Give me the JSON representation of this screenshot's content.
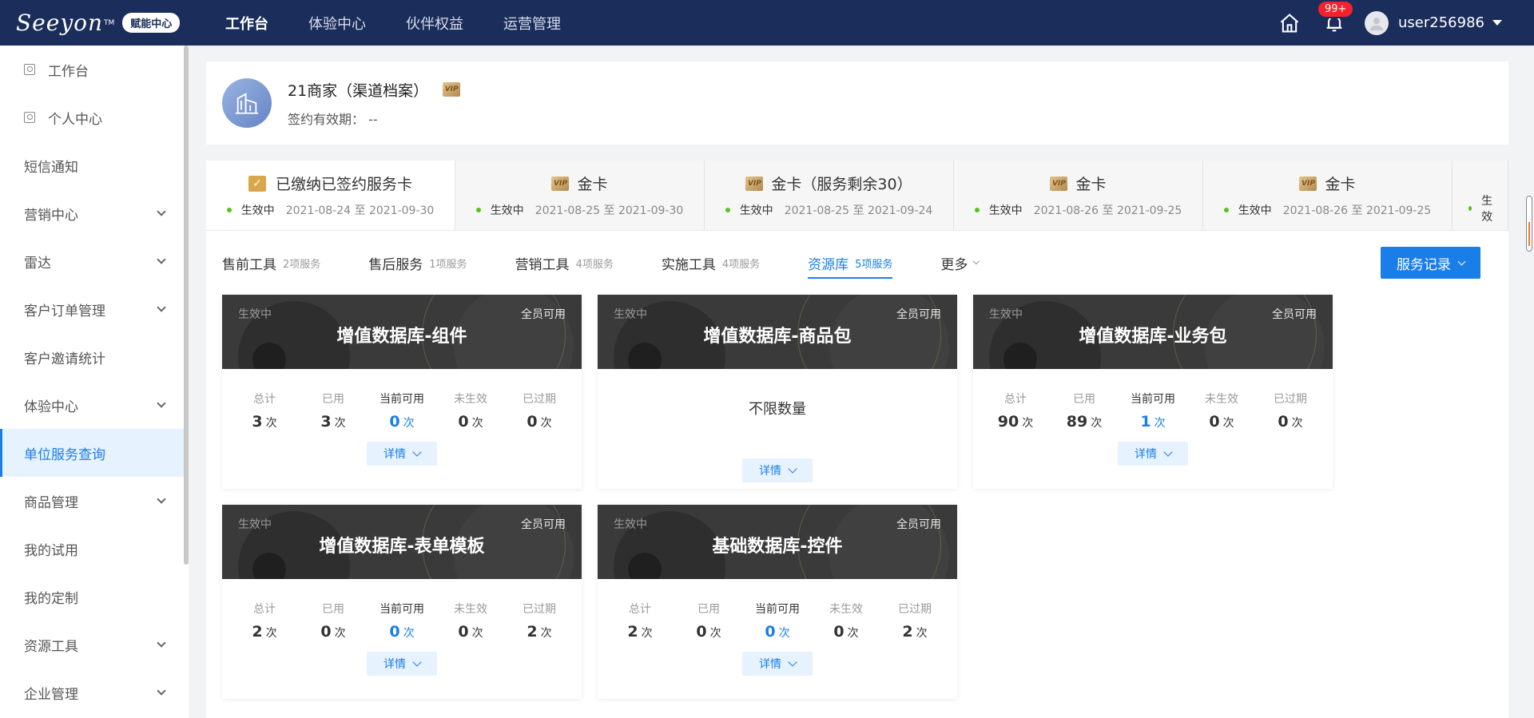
{
  "topbar": {
    "logo": "Seeyon",
    "logo_tm": "TM",
    "badge": "赋能中心",
    "nav": [
      "工作台",
      "体验中心",
      "伙伴权益",
      "运营管理"
    ],
    "notif_count": "99+",
    "username": "user256986"
  },
  "sidebar": {
    "items": [
      "工作台",
      "个人中心",
      "短信通知",
      "营销中心",
      "雷达",
      "客户订单管理",
      "客户邀请统计",
      "体验中心",
      "单位服务查询",
      "商品管理",
      "我的试用",
      "我的定制",
      "资源工具",
      "企业管理"
    ]
  },
  "profile": {
    "name": "21商家（渠道档案）",
    "vip": "VIP",
    "valid_label": "签约有效期：",
    "valid_value": "--"
  },
  "cards": [
    {
      "title": "已缴纳已签约服务卡",
      "status": "生效中",
      "range": "2021-08-24 至 2021-09-30"
    },
    {
      "title": "金卡",
      "status": "生效中",
      "range": "2021-08-25 至 2021-09-30"
    },
    {
      "title": "金卡（服务剩余30）",
      "status": "生效中",
      "range": "2021-08-25 至 2021-09-24"
    },
    {
      "title": "金卡",
      "status": "生效中",
      "range": "2021-08-26 至 2021-09-25"
    },
    {
      "title": "金卡",
      "status": "生效中",
      "range": "2021-08-26 至 2021-09-25"
    },
    {
      "title": "",
      "status": "生效",
      "range": ""
    }
  ],
  "subtabs": [
    {
      "label": "售前工具",
      "count": "2项服务"
    },
    {
      "label": "售后服务",
      "count": "1项服务"
    },
    {
      "label": "营销工具",
      "count": "4项服务"
    },
    {
      "label": "实施工具",
      "count": "4项服务"
    },
    {
      "label": "资源库",
      "count": "5项服务"
    }
  ],
  "more_label": "更多",
  "record_button": "服务记录",
  "stat_labels": [
    "总计",
    "已用",
    "当前可用",
    "未生效",
    "已过期"
  ],
  "unit": "次",
  "detail_label": "详情",
  "services": [
    {
      "status": "生效中",
      "scope": "全员可用",
      "title": "增值数据库-组件",
      "values": [
        "3",
        "3",
        "0",
        "0",
        "0"
      ]
    },
    {
      "status": "生效中",
      "scope": "全员可用",
      "title": "增值数据库-商品包",
      "unlimited": "不限数量"
    },
    {
      "status": "生效中",
      "scope": "全员可用",
      "title": "增值数据库-业务包",
      "values": [
        "90",
        "89",
        "1",
        "0",
        "0"
      ]
    },
    {
      "status": "生效中",
      "scope": "全员可用",
      "title": "增值数据库-表单模板",
      "values": [
        "2",
        "0",
        "0",
        "0",
        "2"
      ]
    },
    {
      "status": "生效中",
      "scope": "全员可用",
      "title": "基础数据库-控件",
      "values": [
        "2",
        "0",
        "0",
        "0",
        "2"
      ]
    }
  ]
}
